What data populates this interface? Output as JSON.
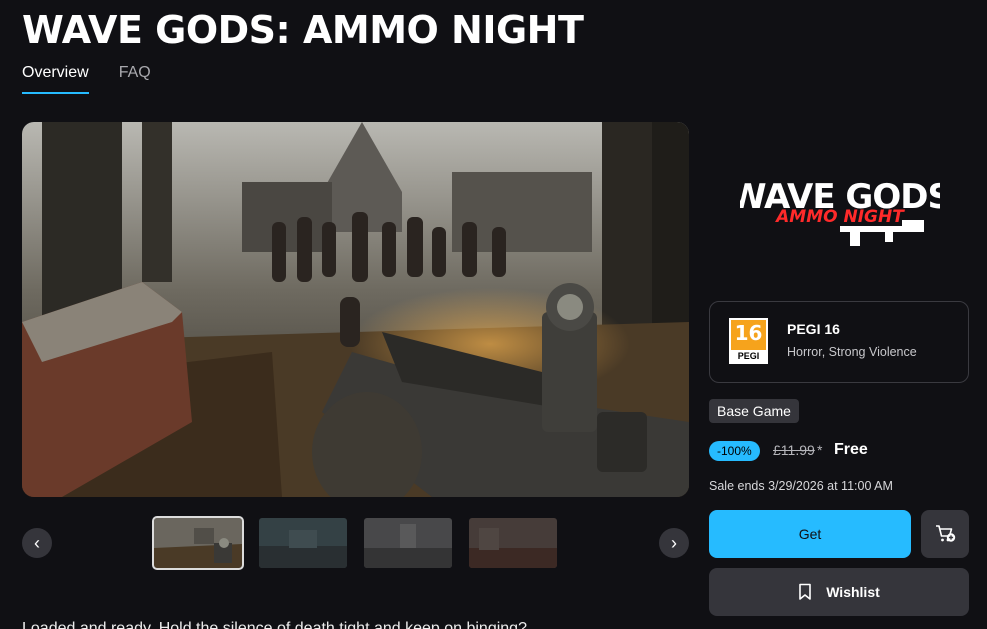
{
  "game": {
    "title": "WAVE GODS: AMMO NIGHT"
  },
  "tabs": [
    {
      "label": "Overview",
      "active": true
    },
    {
      "label": "FAQ",
      "active": false
    }
  ],
  "media": {
    "hero_icon": "zombie-horde-screenshot",
    "prev_icon": "chevron-left-icon",
    "next_icon": "chevron-right-icon",
    "prev_glyph": "‹",
    "next_glyph": "›",
    "thumbnail_count": 4,
    "active_thumbnail": 1
  },
  "logo": {
    "line1": "WAVE GODS",
    "line2": "AMMO NIGHT",
    "accent": "#ff2a2a"
  },
  "rating": {
    "age": "16",
    "badge_word": "PEGI",
    "title": "PEGI 16",
    "descriptors": "Horror, Strong Violence"
  },
  "purchase": {
    "edition": "Base Game",
    "discount": "-100%",
    "original_price": "£11.99",
    "asterisk": "*",
    "price": "Free",
    "sale_ends": "Sale ends 3/29/2026 at 11:00 AM",
    "get_label": "Get",
    "wishlist_label": "Wishlist",
    "cart_icon": "add-to-cart-icon",
    "wishlist_icon": "bookmark-icon"
  },
  "description": {
    "teaser": "Loaded and ready. Hold the silence of death tight and keep on binging?"
  },
  "colors": {
    "accent": "#26bbff",
    "background": "#101014",
    "button": "#35353b",
    "pegi": "#f6a31c"
  }
}
